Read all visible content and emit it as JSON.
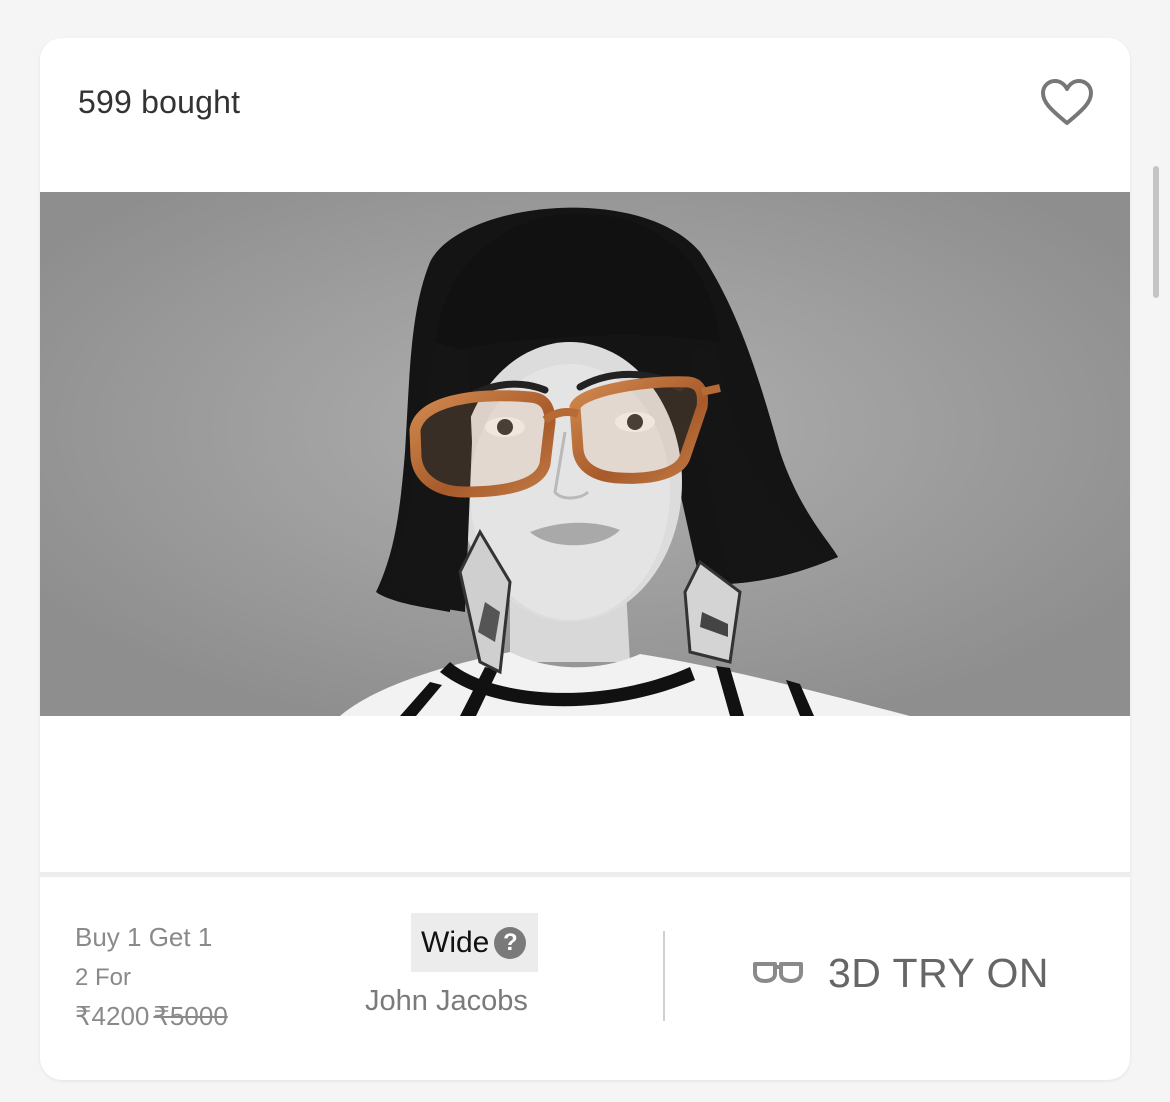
{
  "card": {
    "bought_text": "599 bought",
    "offer": {
      "title": "Buy 1 Get 1",
      "subtitle": "2 For",
      "price": "₹4200",
      "original_price": "₹5000"
    },
    "size_badge": {
      "label": "Wide",
      "help_glyph": "?"
    },
    "brand": "John Jacobs",
    "try_on_label": "3D TRY ON"
  },
  "icons": {
    "wishlist": "heart-outline-icon",
    "help": "question-circle-icon",
    "try_on": "glasses-icon"
  },
  "colors": {
    "background": "#f5f5f5",
    "card": "#ffffff",
    "muted_text": "#8a8a8a",
    "badge_bg": "#ececec",
    "frame_accent": "#b86a35"
  }
}
